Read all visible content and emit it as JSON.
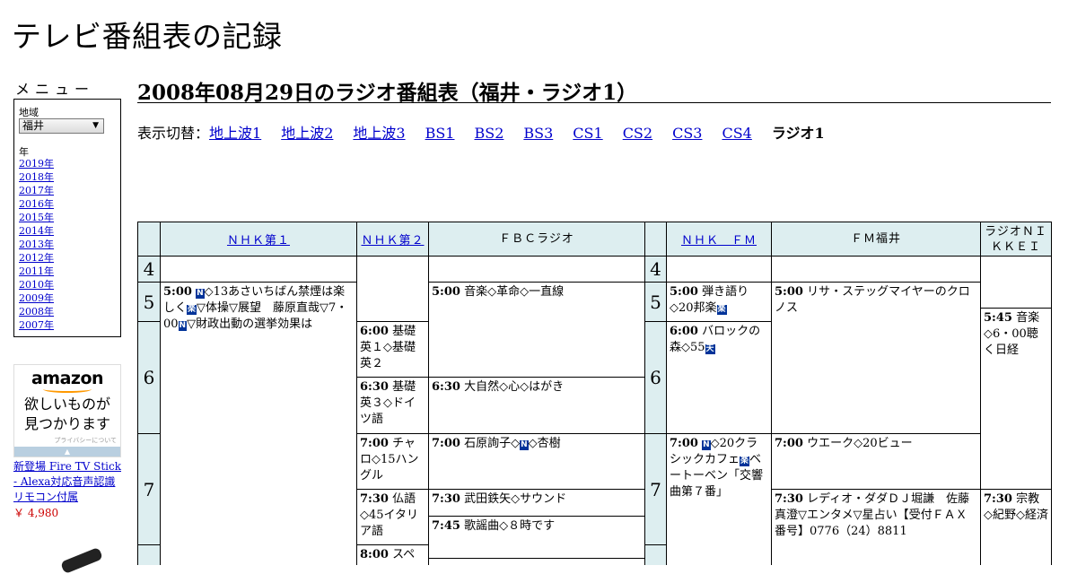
{
  "site": {
    "title": "テレビ番組表の記録"
  },
  "menu": {
    "title": "メニュー",
    "region_label": "地域",
    "region_value": "福井",
    "year_label": "年",
    "years": [
      "2019年",
      "2018年",
      "2017年",
      "2016年",
      "2015年",
      "2014年",
      "2013年",
      "2012年",
      "2011年",
      "2010年",
      "2009年",
      "2008年",
      "2007年"
    ]
  },
  "ad": {
    "logo": "amazon",
    "copy_line1": "欲しいものが",
    "copy_line2": "見つかります",
    "privacy": "プライバシーについて",
    "product_text": "新登場 Fire TV Stick - Alexa対応音声認識リモコン付属",
    "price": "￥ 4,980"
  },
  "page": {
    "title": "2008年08月29日のラジオ番組表（福井・ラジオ1）"
  },
  "switcher": {
    "label": "表示切替：",
    "links": [
      "地上波1",
      "地上波2",
      "地上波3",
      "BS1",
      "BS2",
      "BS3",
      "CS1",
      "CS2",
      "CS3",
      "CS4"
    ],
    "current": "ラジオ1"
  },
  "channels": [
    "ＮＨＫ第１",
    "ＮＨＫ第２",
    "ＦＢＣラジオ",
    "ＮＨＫ　ＦＭ",
    "ＦＭ福井",
    "ラジオＮＩＫＫＥＩ"
  ],
  "hours": [
    "4",
    "5",
    "6",
    "7"
  ],
  "marks": {
    "news": "N",
    "music": "楽",
    "weather": "天"
  },
  "programs": {
    "nhk1_500": {
      "time": "5:00",
      "a": "◇13あさいちばん禁煙は楽しく",
      "b": "▽体操▽展望　藤原直哉▽7・00",
      "c": "▽財政出動の選挙効果は"
    },
    "nhk2_600": {
      "time": "6:00",
      "text": "基礎英１◇基礎英２"
    },
    "nhk2_630": {
      "time": "6:30",
      "text": "基礎英３◇ドイツ語"
    },
    "nhk2_700": {
      "time": "7:00",
      "text": "チャロ◇15ハングル"
    },
    "nhk2_730": {
      "time": "7:30",
      "text": "仏語◇45イタリア語"
    },
    "nhk2_800": {
      "time": "8:00",
      "text": "スペイ"
    },
    "fbc_500": {
      "time": "5:00",
      "text": "音楽◇革命◇一直線"
    },
    "fbc_630": {
      "time": "6:30",
      "text": "大自然◇心◇はがき"
    },
    "fbc_700": {
      "time": "7:00",
      "a": "石原詢子◇",
      "b": "◇杏樹"
    },
    "fbc_730": {
      "time": "7:30",
      "text": "武田鉄矢◇サウンド"
    },
    "fbc_745": {
      "time": "7:45",
      "text": "歌謡曲◇８時です"
    },
    "nfm_500": {
      "time": "5:00",
      "a": "弾き語り◇20邦楽"
    },
    "nfm_600": {
      "time": "6:00",
      "a": "バロックの森◇55"
    },
    "nfm_700": {
      "time": "7:00",
      "a": "◇20クラシックカフェ",
      "b": "ベートーベン「交響曲第７番」"
    },
    "fmf_500": {
      "time": "5:00",
      "text": "リサ・ステッグマイヤーのクロノス"
    },
    "fmf_700": {
      "time": "7:00",
      "text": "ウエーク◇20ビュー"
    },
    "fmf_730": {
      "time": "7:30",
      "text": "レディオ・ダダＤＪ堀謙　佐藤真澄▽エンタメ▽星占い【受付ＦＡＸ番号】0776（24）8811"
    },
    "nik_545": {
      "time": "5:45",
      "text": "音楽◇6・00聴く日経"
    },
    "nik_730": {
      "time": "7:30",
      "text": "宗教◇紀野◇経済"
    }
  }
}
